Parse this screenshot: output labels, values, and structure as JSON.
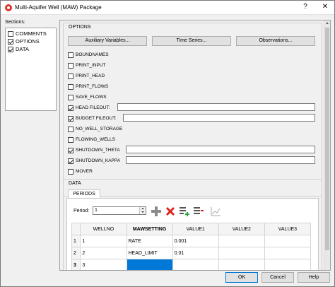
{
  "window": {
    "title": "Multi-Aquifer Well (MAW) Package",
    "help_label": "?",
    "close_label": "✕"
  },
  "sections": {
    "label": "Sections:",
    "items": [
      {
        "label": "COMMENTS",
        "checked": false
      },
      {
        "label": "OPTIONS",
        "checked": true
      },
      {
        "label": "DATA",
        "checked": true
      }
    ]
  },
  "options": {
    "group_title": "OPTIONS",
    "buttons": {
      "aux": "Auxiliary Variables...",
      "time_series": "Time Series...",
      "observations": "Observations..."
    },
    "items": [
      {
        "label": "BOUNDNAMES",
        "checked": false
      },
      {
        "label": "PRINT_INPUT",
        "checked": false
      },
      {
        "label": "PRINT_HEAD",
        "checked": false
      },
      {
        "label": "PRINT_FLOWS",
        "checked": false
      },
      {
        "label": "SAVE_FLOWS",
        "checked": false
      },
      {
        "label": "HEAD FILEOUT:",
        "checked": true,
        "value": ""
      },
      {
        "label": "BUDGET FILEOUT:",
        "checked": true,
        "value": ""
      },
      {
        "label": "NO_WELL_STORAGE",
        "checked": false
      },
      {
        "label": "FLOWING_WELLS",
        "checked": false
      },
      {
        "label": "SHUTDOWN_THETA",
        "checked": true,
        "value": ""
      },
      {
        "label": "SHUTDOWN_KAPPA",
        "checked": true,
        "value": ""
      },
      {
        "label": "MOVER",
        "checked": false
      }
    ]
  },
  "data": {
    "group_title": "DATA",
    "tab_label": "PERIODS",
    "period_label": "Period:",
    "period_value": "1",
    "toolbar_icons": [
      "add-row-icon",
      "delete-row-icon",
      "insert-row-icon",
      "remove-rows-icon",
      "chart-icon"
    ],
    "columns": [
      "",
      "WELLNO",
      "MAWSETTING",
      "VALUE1",
      "VALUE2",
      "VALUE3"
    ],
    "rows": [
      {
        "num": "1",
        "cells": [
          "1",
          "RATE",
          "0.001",
          "",
          ""
        ]
      },
      {
        "num": "2",
        "cells": [
          "2",
          "HEAD_LIMIT",
          "0.01",
          "",
          ""
        ]
      },
      {
        "num": "3",
        "cells": [
          "3",
          "",
          "",
          "",
          ""
        ]
      }
    ]
  },
  "footer": {
    "ok": "OK",
    "cancel": "Cancel",
    "help": "Help"
  }
}
